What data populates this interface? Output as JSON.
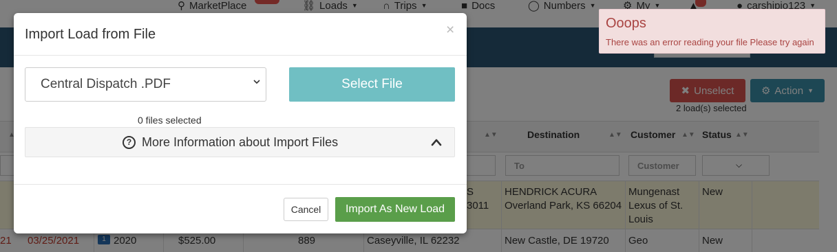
{
  "nav": {
    "marketplace": "MarketPlace",
    "loads": "Loads",
    "trips": "Trips",
    "docs": "Docs",
    "numbers": "Numbers",
    "my": "My",
    "user": "carshipio123"
  },
  "toolbar": {
    "unselect": "Unselect",
    "action": "Action",
    "selected_count": "2 load(s) selected"
  },
  "table": {
    "headers": {
      "destination": "Destination",
      "customer": "Customer",
      "status": "Status"
    },
    "filters": {
      "to_placeholder": "To",
      "customer_placeholder": "Customer"
    },
    "row1": {
      "origin_frag1": "S",
      "origin_frag2": "3011",
      "dest1": "HENDRICK ACURA",
      "dest2": "Overland Park, KS 66204",
      "cust1": "Mungenast",
      "cust2": "Lexus of St.",
      "cust3": "Louis",
      "status": "New"
    },
    "row2": {
      "id_frag": "21",
      "date": "03/25/2021",
      "badge": "1",
      "year": "2020",
      "price": "$525.00",
      "miles": "889",
      "origin": "Caseyville, IL 62232",
      "dest": "New Castle, DE 19720",
      "cust": "Geo",
      "status": "New"
    }
  },
  "modal": {
    "title": "Import Load from File",
    "close": "×",
    "format_value": "Central Dispatch .PDF",
    "select_file": "Select File",
    "files_selected": "0 files selected",
    "info_label": "More Information about Import Files",
    "info_icon": "?",
    "cancel": "Cancel",
    "import": "Import As New Load"
  },
  "toast": {
    "title": "Ooops",
    "message": "There was an error reading your file Please try again"
  },
  "colors": {
    "select_file_btn": "#70bfc3",
    "import_btn": "#5a9e4a",
    "toast_bg": "#f2dede",
    "toast_text": "#a94442",
    "unselect_btn": "#d9534f",
    "action_btn": "#3a8fa8"
  }
}
